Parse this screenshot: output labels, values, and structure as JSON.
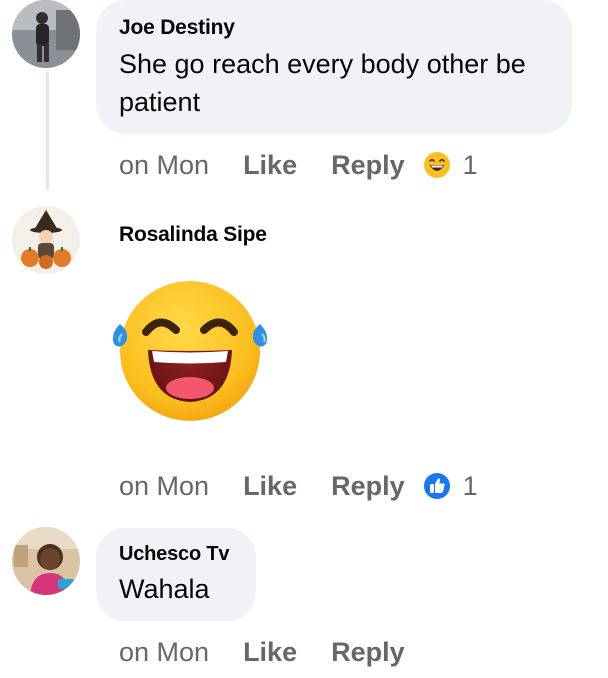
{
  "comments": [
    {
      "author": "Joe Destiny",
      "text": "She go reach every body other be patient",
      "time": "on Mon",
      "like_label": "Like",
      "reply_label": "Reply",
      "reaction_icon": "laughing-emoji-icon",
      "reaction_count": "1"
    },
    {
      "author": "Rosalinda Sipe",
      "sticker": "tears-of-joy-emoji",
      "time": "on Mon",
      "like_label": "Like",
      "reply_label": "Reply",
      "reaction_icon": "like-thumb-icon",
      "reaction_count": "1"
    },
    {
      "author": "Uchesco Tv",
      "text": "Wahala",
      "time": "on Mon",
      "like_label": "Like",
      "reply_label": "Reply"
    }
  ],
  "colors": {
    "bubble": "#f0f2f5",
    "meta_text": "#65676b",
    "like_blue": "#1877f2",
    "emoji_yellow": "#f9c025"
  }
}
